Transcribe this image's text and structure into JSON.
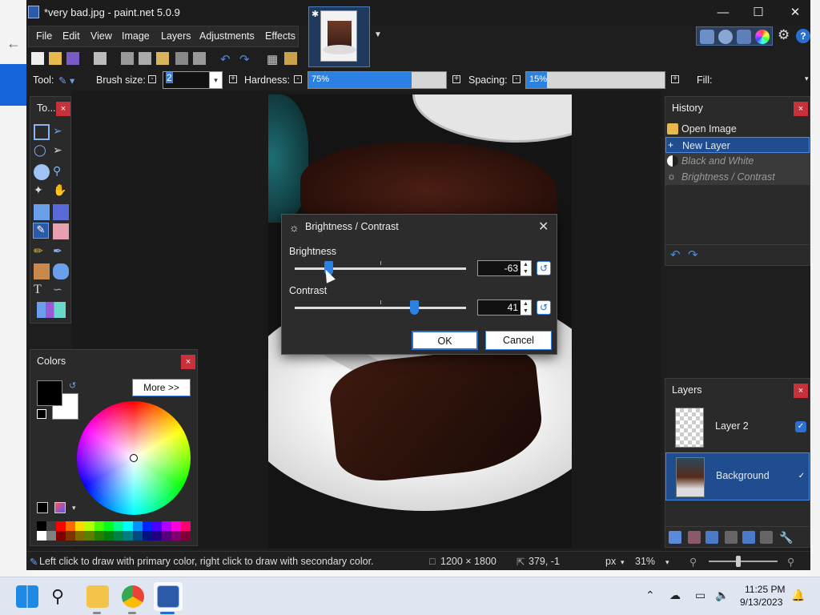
{
  "window": {
    "title": "*very bad.jpg - paint.net 5.0.9"
  },
  "menu": [
    "File",
    "Edit",
    "View",
    "Image",
    "Layers",
    "Adjustments",
    "Effects"
  ],
  "toolbar": {
    "tool_label": "Tool:",
    "brush_size_label": "Brush size:",
    "brush_size_value": "2",
    "hardness_label": "Hardness:",
    "hardness_value": "75%",
    "hardness_fraction": 0.75,
    "spacing_label": "Spacing:",
    "spacing_value": "15%",
    "spacing_fraction": 0.15,
    "fill_label": "Fill:"
  },
  "tools_panel": {
    "title": "To...",
    "close": "×"
  },
  "colors_panel": {
    "title": "Colors",
    "close": "×",
    "more_button": "More >>",
    "primary_color": "#000000",
    "secondary_color": "#ffffff"
  },
  "history_panel": {
    "title": "History",
    "close": "×",
    "items": [
      {
        "label": "Open Image",
        "state": "normal",
        "icon": "folder-icon"
      },
      {
        "label": "New Layer",
        "state": "selected",
        "icon": "new-layer-icon"
      },
      {
        "label": "Black and White",
        "state": "undone",
        "icon": "black-white-icon"
      },
      {
        "label": "Brightness / Contrast",
        "state": "undone",
        "icon": "brightness-icon"
      }
    ]
  },
  "layers_panel": {
    "title": "Layers",
    "close": "×",
    "layers": [
      {
        "name": "Layer 2",
        "visible": true,
        "selected": false
      },
      {
        "name": "Background",
        "visible": true,
        "selected": true
      }
    ]
  },
  "dialog": {
    "title": "Brightness / Contrast",
    "brightness_label": "Brightness",
    "brightness_value": "-63",
    "contrast_label": "Contrast",
    "contrast_value": "41",
    "ok": "OK",
    "cancel": "Cancel"
  },
  "status": {
    "hint": "Left click to draw with primary color, right click to draw with secondary color.",
    "image_size": "1200 × 1800",
    "cursor_pos": "379, -1",
    "units": "px",
    "zoom": "31%"
  },
  "taskbar": {
    "time": "11:25 PM",
    "date": "9/13/2023"
  },
  "colors": {
    "accent": "#2b6fd1",
    "close_red": "#c8303a"
  }
}
